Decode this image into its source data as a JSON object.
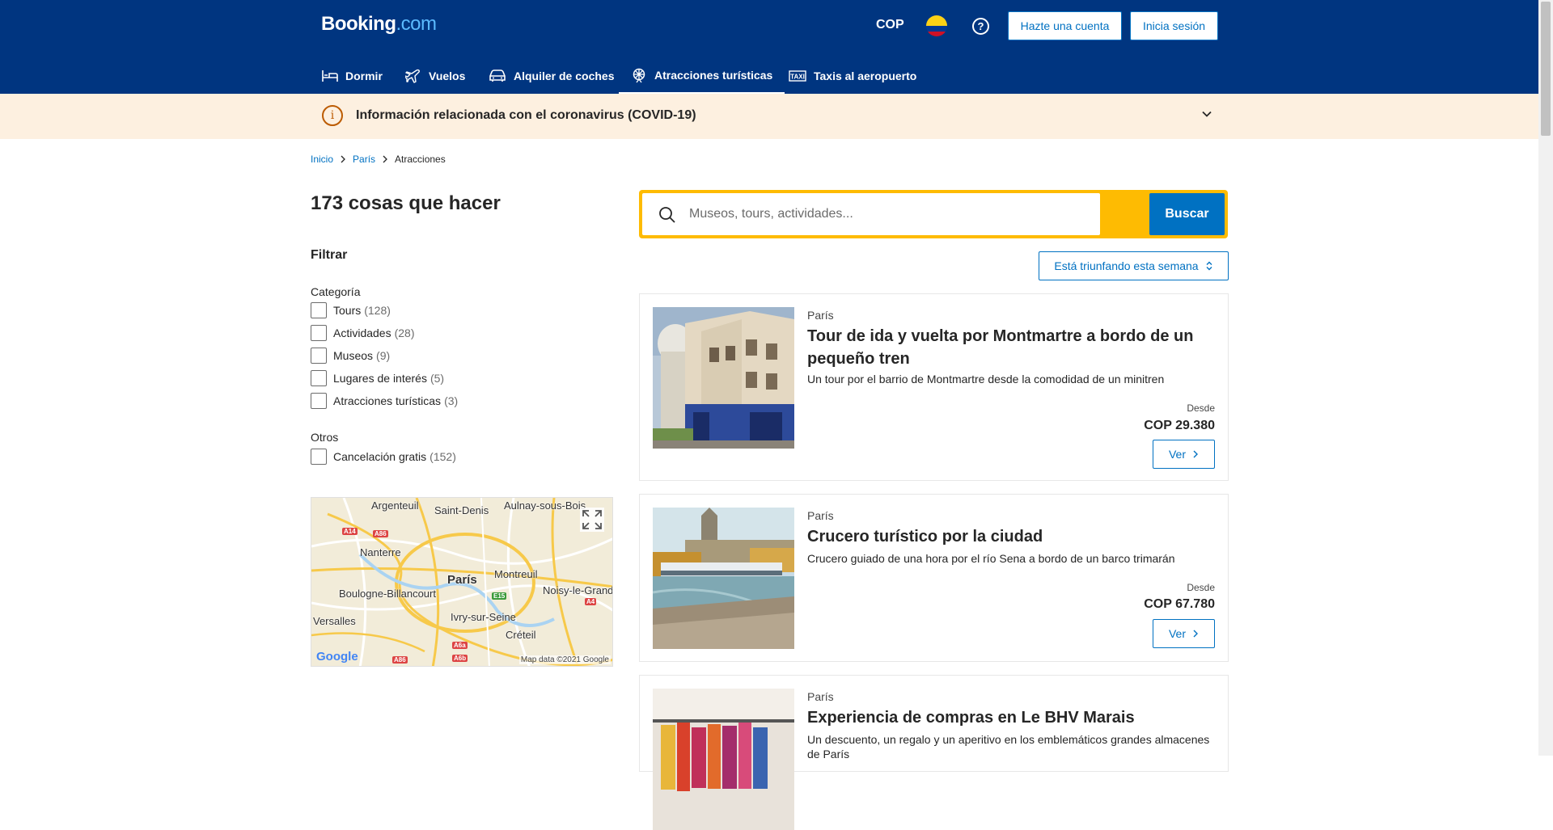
{
  "header": {
    "logo_main": "Booking",
    "logo_dot": ".com",
    "currency": "COP",
    "help_icon": "?",
    "create_account": "Hazte una cuenta",
    "sign_in": "Inicia sesión",
    "nav": [
      {
        "label": "Dormir",
        "icon": "bed-icon"
      },
      {
        "label": "Vuelos",
        "icon": "plane-icon"
      },
      {
        "label": "Alquiler de coches",
        "icon": "car-icon"
      },
      {
        "label": "Atracciones turísticas",
        "icon": "ferris-wheel-icon",
        "active": true
      },
      {
        "label": "Taxis al aeropuerto",
        "icon": "taxi-icon"
      }
    ],
    "colors": {
      "brand": "#003580",
      "accent": "#0071c2",
      "search_border": "#febb02"
    }
  },
  "covid": {
    "icon": "i",
    "text": "Información relacionada con el coronavirus (COVID-19)"
  },
  "breadcrumb": {
    "home": "Inicio",
    "city": "París",
    "current": "Atracciones"
  },
  "results": {
    "title": "173 cosas que hacer"
  },
  "filters": {
    "heading": "Filtrar",
    "category_heading": "Categoría",
    "categories": [
      {
        "label": "Tours",
        "count": "(128)"
      },
      {
        "label": "Actividades",
        "count": "(28)"
      },
      {
        "label": "Museos",
        "count": "(9)"
      },
      {
        "label": "Lugares de interés",
        "count": "(5)"
      },
      {
        "label": "Atracciones turísticas",
        "count": "(3)"
      }
    ],
    "others_heading": "Otros",
    "others": [
      {
        "label": "Cancelación gratis",
        "count": "(152)"
      }
    ]
  },
  "map": {
    "labels": [
      "Argenteuil",
      "Saint-Denis",
      "Aulnay-sous-Bois",
      "Nanterre",
      "París",
      "Montreuil",
      "Boulogne-Billancourt",
      "Noisy-le-Grand",
      "Versalles",
      "Ivry-sur-Seine",
      "Créteil"
    ],
    "roads": [
      "A14",
      "A86",
      "E15",
      "A4",
      "A6a",
      "A6b",
      "A86"
    ],
    "google": "Google",
    "copyright": "Map data ©2021 Google"
  },
  "search": {
    "placeholder": "Museos, tours, actividades...",
    "button": "Buscar"
  },
  "sort": {
    "label": "Está triunfando esta semana"
  },
  "cards": [
    {
      "city": "París",
      "title": "Tour de ida y vuelta por Montmartre a bordo de un pequeño tren",
      "description": "Un tour por el barrio de Montmartre desde la comodidad de un minitren",
      "from": "Desde",
      "price": "COP 29.380",
      "button": "Ver"
    },
    {
      "city": "París",
      "title": "Crucero turístico por la ciudad",
      "description": "Crucero guiado de una hora por el río Sena a bordo de un barco trimarán",
      "from": "Desde",
      "price": "COP 67.780",
      "button": "Ver"
    },
    {
      "city": "París",
      "title": "Experiencia de compras en Le BHV Marais",
      "description": "Un descuento, un regalo y un aperitivo en los emblemáticos grandes almacenes de París"
    }
  ]
}
